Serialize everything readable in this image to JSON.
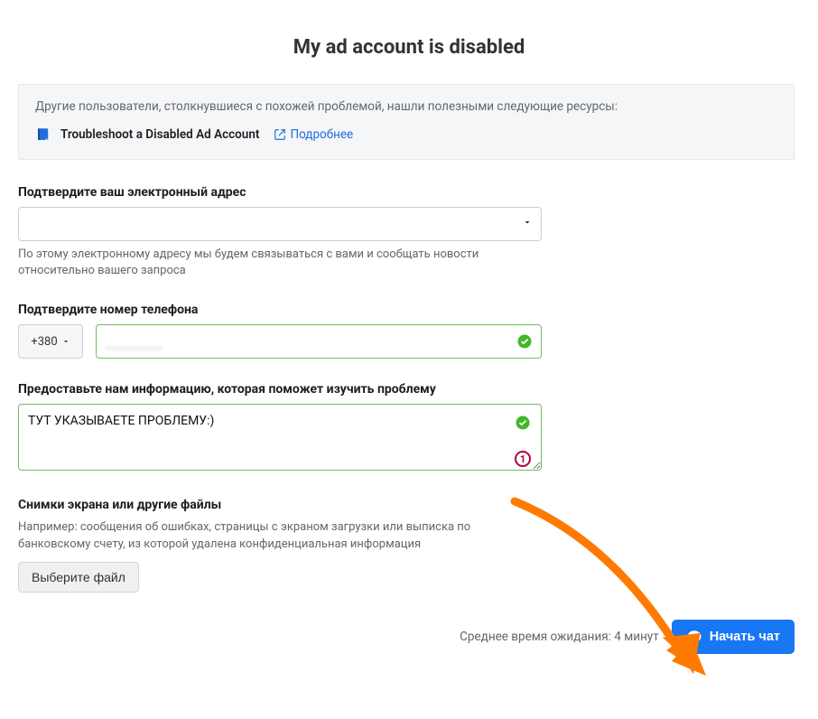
{
  "page": {
    "title": "My ad account is disabled"
  },
  "resources": {
    "intro": "Другие пользователи, столкнувшиеся с похожей проблемой, нашли полезными следующие ресурсы:",
    "item_title": "Troubleshoot a Disabled Ad Account",
    "more_label": "Подробнее"
  },
  "email": {
    "label": "Подтвердите ваш электронный адрес",
    "value": "",
    "help": "По этому электронному адресу мы будем связываться с вами и сообщать новости относительно вашего запроса"
  },
  "phone": {
    "label": "Подтвердите номер телефона",
    "country_code": "+380",
    "value": ""
  },
  "problem": {
    "label": "Предоставьте нам информацию, которая поможет изучить проблему",
    "value": "ТУТ УКАЗЫВАЕТЕ ПРОБЛЕМУ:)"
  },
  "files": {
    "label": "Снимки экрана или другие файлы",
    "help": "Например: сообщения об ошибках, страницы с экраном загрузки или выписка по банковскому счету, из которой удалена конфиденциальная информация",
    "button": "Выберите файл"
  },
  "footer": {
    "wait_text": "Среднее время ожидания: 4 минут",
    "chat_button": "Начать чат"
  },
  "annotation": {
    "step": "1"
  }
}
